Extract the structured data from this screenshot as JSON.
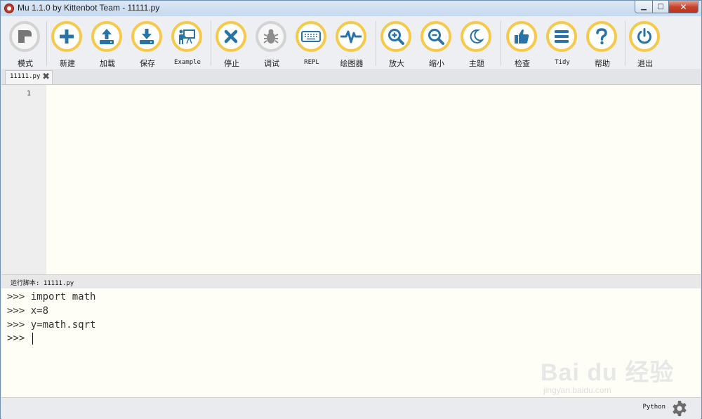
{
  "window": {
    "title": "Mu 1.1.0 by Kittenbot Team - 11111.py",
    "controls": {
      "minimize": "▁",
      "maximize": "□",
      "close": "✕"
    }
  },
  "toolbar": {
    "buttons": [
      {
        "label": "模式",
        "icon": "mode-icon"
      },
      {
        "label": "新建",
        "icon": "plus-icon"
      },
      {
        "label": "加载",
        "icon": "upload-icon"
      },
      {
        "label": "保存",
        "icon": "download-icon"
      },
      {
        "label": "Example",
        "icon": "presentation-icon"
      },
      {
        "label": "停止",
        "icon": "stop-x-icon"
      },
      {
        "label": "调试",
        "icon": "bug-icon"
      },
      {
        "label": "REPL",
        "icon": "keyboard-icon"
      },
      {
        "label": "绘图器",
        "icon": "waveform-icon"
      },
      {
        "label": "放大",
        "icon": "zoom-in-icon"
      },
      {
        "label": "缩小",
        "icon": "zoom-out-icon"
      },
      {
        "label": "主题",
        "icon": "moon-icon"
      },
      {
        "label": "检查",
        "icon": "thumbs-up-icon"
      },
      {
        "label": "Tidy",
        "icon": "lines-icon"
      },
      {
        "label": "帮助",
        "icon": "question-icon"
      },
      {
        "label": "退出",
        "icon": "power-icon"
      }
    ]
  },
  "tabs": [
    {
      "label": "11111.py",
      "close": "✖"
    }
  ],
  "editor": {
    "line_numbers": [
      "1"
    ]
  },
  "repl": {
    "title": "运行脚本: 11111.py",
    "lines": [
      ">>> import math",
      ">>> x=8",
      ">>> y=math.sqrt",
      ">>> "
    ]
  },
  "status": {
    "mode": "Python",
    "settings_icon": "gear-icon"
  },
  "watermark": {
    "main": "Bai du 经验",
    "sub": "jingyan.baidu.com"
  },
  "colors": {
    "accent": "#f6c94a",
    "icon": "#2874a6",
    "editor_bg": "#fefef7"
  }
}
